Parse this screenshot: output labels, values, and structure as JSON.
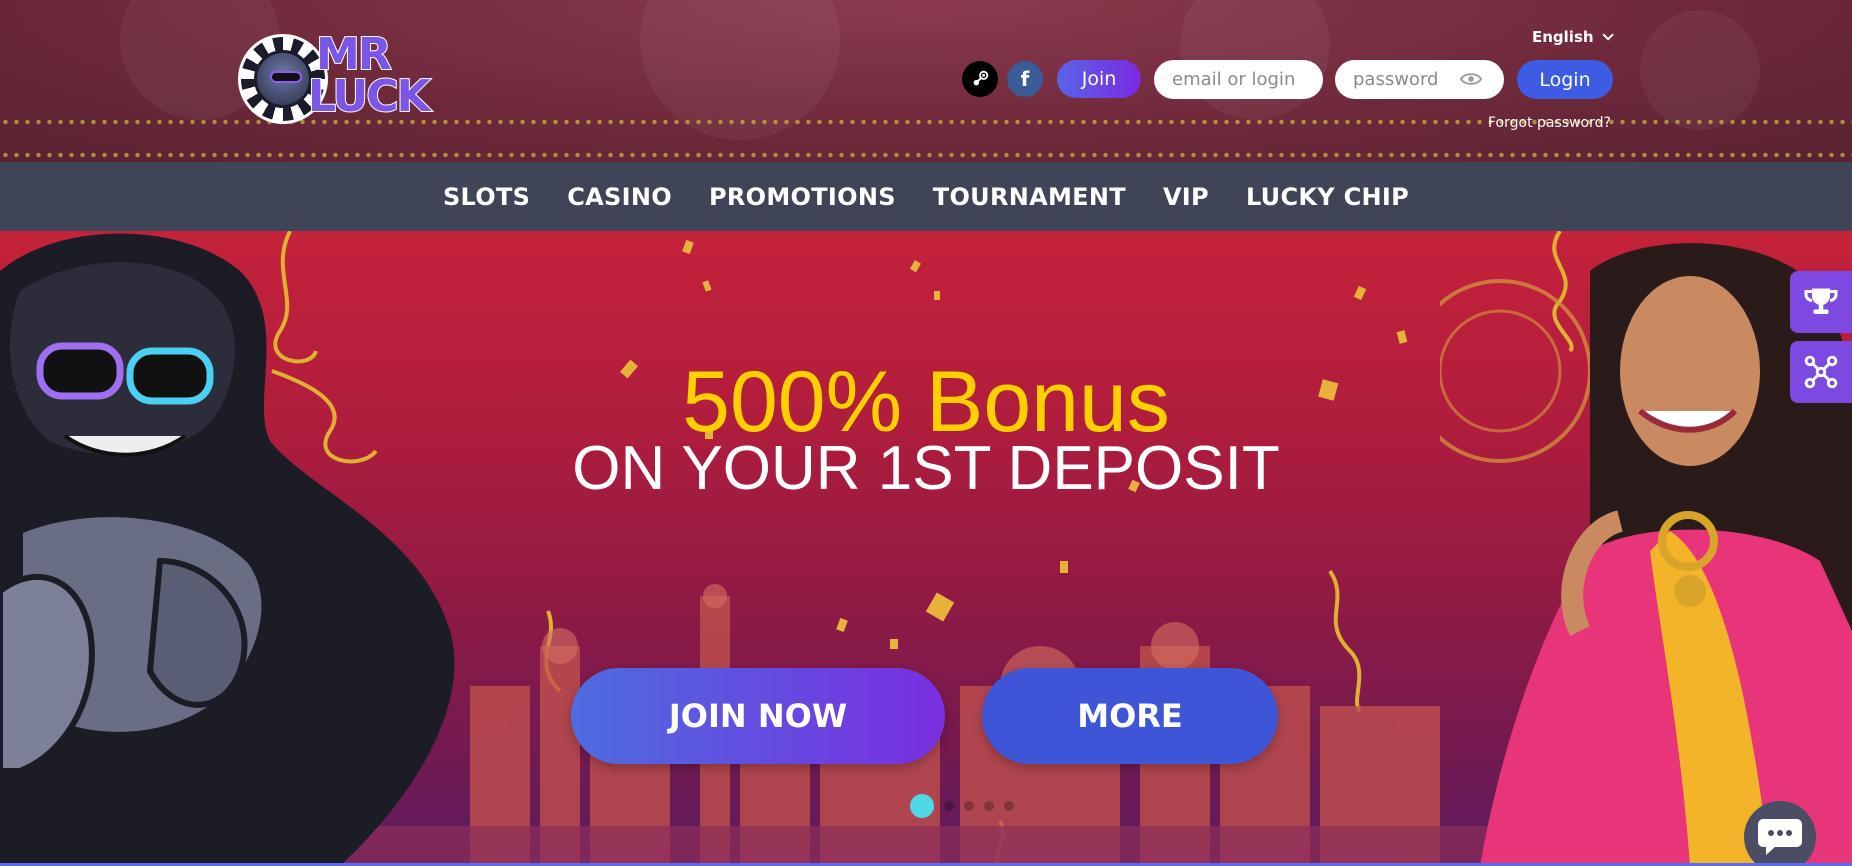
{
  "header": {
    "logo_alt": "MR LUCK",
    "logo_line1": "MR",
    "logo_line2": "LUCK",
    "language": "English",
    "join_label": "Join",
    "email_placeholder": "email or login",
    "password_placeholder": "password",
    "login_label": "Login",
    "forgot_label": "Forgot password?"
  },
  "nav": {
    "items": [
      {
        "label": "SLOTS"
      },
      {
        "label": "CASINO"
      },
      {
        "label": "PROMOTIONS"
      },
      {
        "label": "TOURNAMENT"
      },
      {
        "label": "VIP"
      },
      {
        "label": "LUCKY CHIP"
      }
    ]
  },
  "hero": {
    "headline": "500% Bonus",
    "subline": "ON YOUR 1ST DEPOSIT",
    "join_now_label": "JOIN NOW",
    "more_label": "MORE",
    "slides": {
      "count": 5,
      "active": 1
    }
  },
  "side_tabs": [
    {
      "icon": "trophy-icon"
    },
    {
      "icon": "network-icon"
    }
  ],
  "chat": {
    "icon": "chat-icon"
  },
  "colors": {
    "accent": "#7c4ae0",
    "login": "#3e5ce3",
    "headline": "#ffd000",
    "active_dot": "#4ed8e6"
  }
}
